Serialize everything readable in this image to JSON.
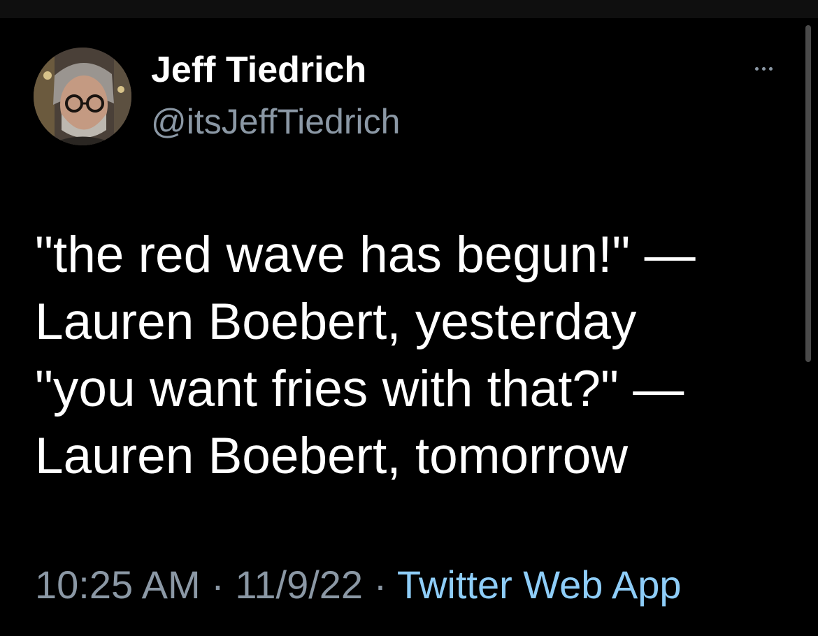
{
  "author": {
    "display_name": "Jeff Tiedrich",
    "handle": "@itsJeffTiedrich",
    "avatar_icon": "profile-photo-avatar"
  },
  "more_icon": "ellipsis-icon",
  "tweet": {
    "lines": [
      "\"the red wave has begun!\" —",
      "Lauren Boebert, yesterday",
      "\"you want fries with that?\" —",
      "Lauren Boebert, tomorrow"
    ]
  },
  "meta": {
    "time": "10:25 AM",
    "separator": " · ",
    "date": "11/9/22",
    "source": "Twitter Web App"
  },
  "colors": {
    "background": "#000000",
    "primary_text": "#ffffff",
    "secondary_text": "#8b98a5",
    "link": "#8ecdf8"
  }
}
